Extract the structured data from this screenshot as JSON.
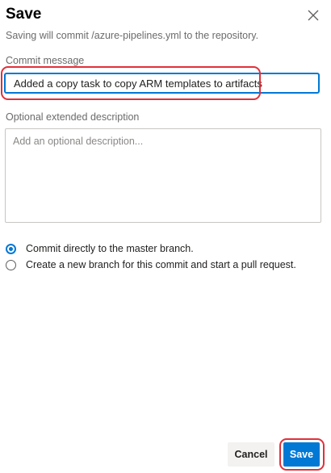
{
  "dialog": {
    "title": "Save",
    "subtitle": "Saving will commit /azure-pipelines.yml to the repository.",
    "close_icon": "close-icon"
  },
  "commit": {
    "label": "Commit message",
    "value": "Added a copy task to copy ARM templates to artifacts"
  },
  "description": {
    "label": "Optional extended description",
    "placeholder": "Add an optional description...",
    "value": ""
  },
  "branch_options": [
    {
      "label": "Commit directly to the master branch.",
      "selected": true
    },
    {
      "label": "Create a new branch for this commit and start a pull request.",
      "selected": false
    }
  ],
  "buttons": {
    "cancel": "Cancel",
    "save": "Save"
  },
  "colors": {
    "accent": "#0078d4",
    "highlight": "#e0313b"
  }
}
